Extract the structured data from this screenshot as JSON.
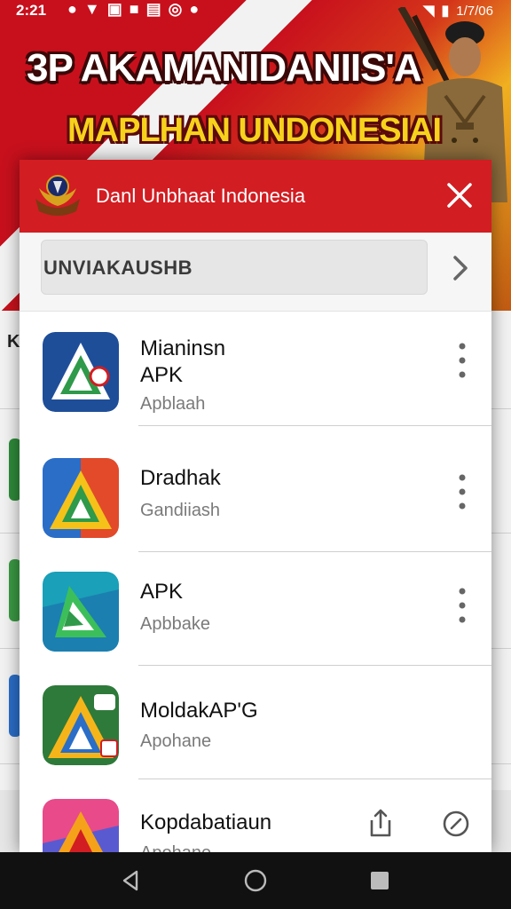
{
  "status_bar": {
    "time": "2:21",
    "right_text": "1/7/06"
  },
  "banner": {
    "title": "3P AKAMANIDANIIS'A",
    "subtitle": "MAPLHAN UNDONESIAI"
  },
  "dialog": {
    "title": "Danl Unbhaat Indonesia",
    "search": {
      "value": "UNVIAKAUSHB"
    },
    "apps": [
      {
        "name_line1": "Mianinsn",
        "name_line2": "APK",
        "subtitle": "Apblaah"
      },
      {
        "name_line1": "Dradhak",
        "name_line2": "",
        "subtitle": "Gandiiash"
      },
      {
        "name_line1": "APK",
        "name_line2": "",
        "subtitle": "Apbbake"
      },
      {
        "name_line1": "MoldakAP'G",
        "name_line2": "",
        "subtitle": "Apohane"
      },
      {
        "name_line1": "Kopdabatiaun",
        "name_line2": "",
        "subtitle": "Apohane"
      }
    ]
  },
  "underlying": {
    "letter": "K"
  },
  "colors": {
    "header_red": "#d21d22",
    "banner_yellow": "#f7d21c"
  },
  "icons": [
    "emblem-icon",
    "close-icon",
    "chevron-right-icon",
    "more-vertical-icon",
    "share-icon",
    "compass-icon",
    "back-icon",
    "home-icon",
    "recents-icon"
  ]
}
